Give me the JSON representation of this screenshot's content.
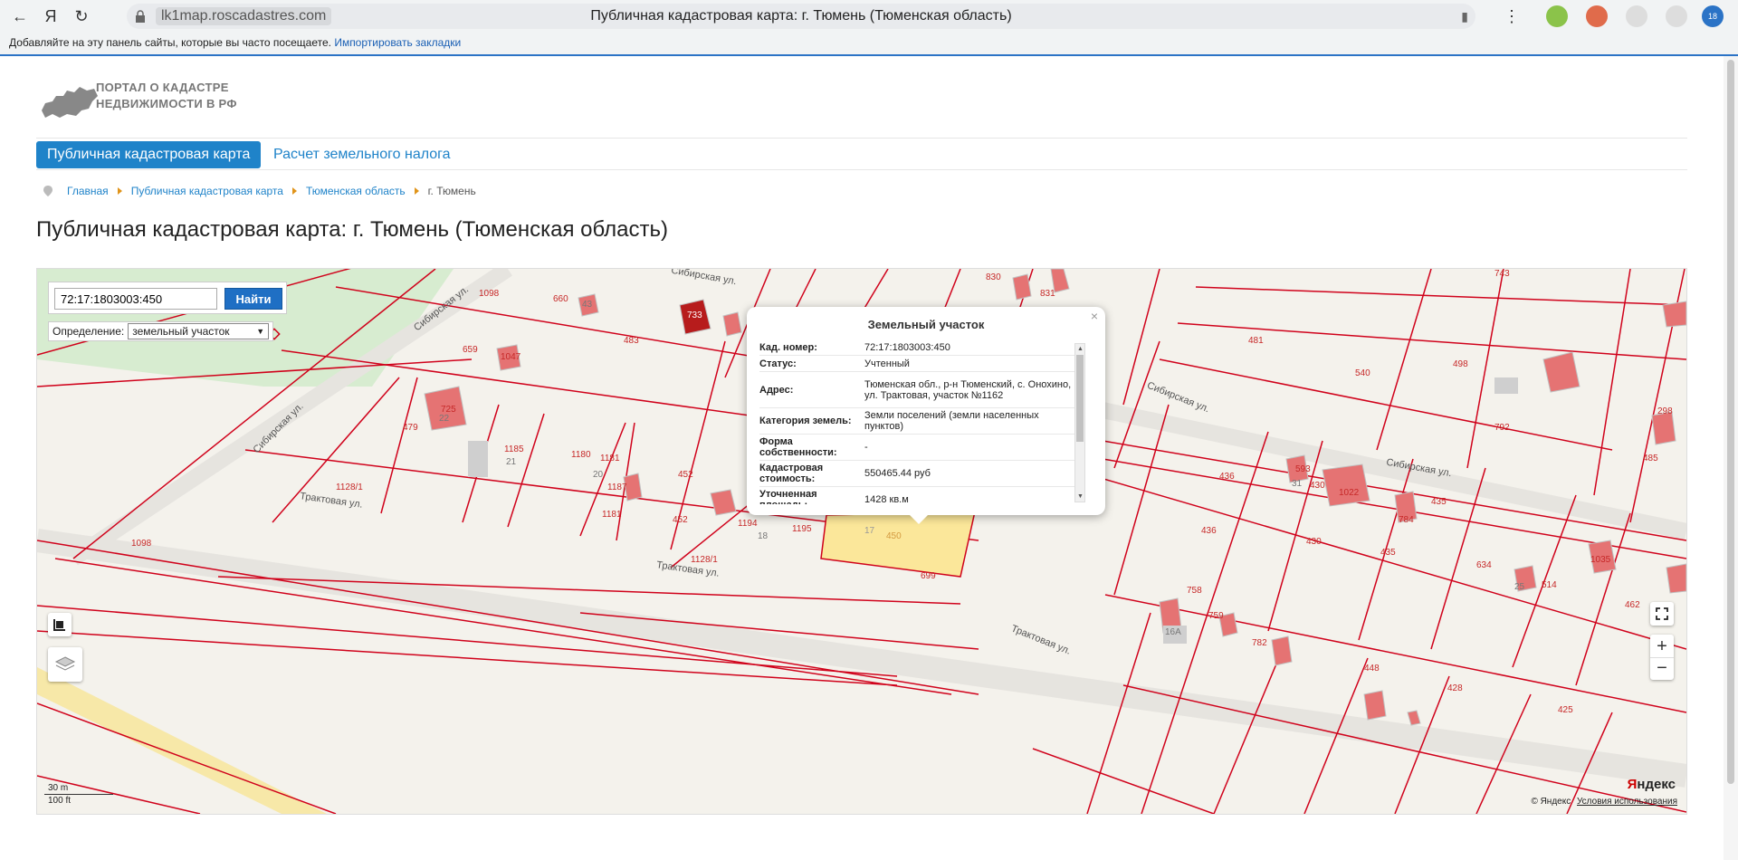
{
  "browser": {
    "host": "lk1map.roscadastres.com",
    "tab_title": "Публичная кадастровая карта: г. Тюмень (Тюменская область)",
    "bookmarks_hint": "Добавляйте на эту панель сайты, которые вы часто посещаете.",
    "import_bookmarks": "Импортировать закладки",
    "ext_badge": "18"
  },
  "site": {
    "logo_line1": "ПОРТАЛ О КАДАСТРЕ",
    "logo_line2": "НЕДВИЖИМОСТИ В РФ"
  },
  "tabs": {
    "active": "Публичная кадастровая карта",
    "link": "Расчет земельного налога"
  },
  "breadcrumb": [
    "Главная",
    "Публичная кадастровая карта",
    "Тюменская область",
    "г. Тюмень"
  ],
  "page_title": "Публичная кадастровая карта: г. Тюмень (Тюменская область)",
  "search": {
    "value": "72:17:1803003:450",
    "button": "Найти",
    "definition_label": "Определение:",
    "definition_value": "земельный участок"
  },
  "popup": {
    "title": "Земельный участок",
    "rows": [
      {
        "key": "Кад. номер:",
        "value": "72:17:1803003:450"
      },
      {
        "key": "Статус:",
        "value": "Учтенный"
      },
      {
        "key": "Адрес:",
        "value": "Тюменская обл., р-н Тюменский, с. Онохино, ул. Трактовая, участок №1162"
      },
      {
        "key": "Категория земель:",
        "value": "Земли поселений (земли населенных пунктов)"
      },
      {
        "key": "Форма собственности:",
        "value": "-"
      },
      {
        "key": "Кадастровая стоимость:",
        "value": "550465.44 руб"
      },
      {
        "key": "Уточненная площадь:",
        "value": "1428 кв.м"
      }
    ]
  },
  "map": {
    "scale_metric": "30 m",
    "scale_imperial": "100 ft",
    "attribution": "© Яндекс",
    "terms": "Условия использования",
    "yandex_logo_red": "Я",
    "yandex_logo_rest": "ндекс",
    "labels": [
      {
        "text": "1098"
      },
      {
        "text": "660"
      },
      {
        "text": "43"
      },
      {
        "text": "733"
      },
      {
        "text": "483"
      },
      {
        "text": "659"
      },
      {
        "text": "1047"
      },
      {
        "text": "479"
      },
      {
        "text": "22"
      },
      {
        "text": "725"
      },
      {
        "text": "1185"
      },
      {
        "text": "21"
      },
      {
        "text": "1180"
      },
      {
        "text": "1181"
      },
      {
        "text": "20"
      },
      {
        "text": "1187"
      },
      {
        "text": "452"
      },
      {
        "text": "1128/1"
      },
      {
        "text": "1098"
      },
      {
        "text": "1181"
      },
      {
        "text": "452"
      },
      {
        "text": "1194"
      },
      {
        "text": "1195"
      },
      {
        "text": "18"
      },
      {
        "text": "17"
      },
      {
        "text": "450"
      },
      {
        "text": "1128/1"
      },
      {
        "text": "699"
      },
      {
        "text": "830"
      },
      {
        "text": "831"
      },
      {
        "text": "481"
      },
      {
        "text": "540"
      },
      {
        "text": "498"
      },
      {
        "text": "792"
      },
      {
        "text": "743"
      },
      {
        "text": "298"
      },
      {
        "text": "485"
      },
      {
        "text": "436"
      },
      {
        "text": "430"
      },
      {
        "text": "1022"
      },
      {
        "text": "435"
      },
      {
        "text": "784"
      },
      {
        "text": "436"
      },
      {
        "text": "430"
      },
      {
        "text": "435"
      },
      {
        "text": "634"
      },
      {
        "text": "25"
      },
      {
        "text": "514"
      },
      {
        "text": "1035"
      },
      {
        "text": "462"
      },
      {
        "text": "758"
      },
      {
        "text": "759"
      },
      {
        "text": "782"
      },
      {
        "text": "448"
      },
      {
        "text": "428"
      },
      {
        "text": "425"
      },
      {
        "text": "16А"
      },
      {
        "text": "593"
      },
      {
        "text": "31"
      }
    ],
    "streets": [
      {
        "text": "Сибирская ул."
      },
      {
        "text": "Сибирская ул."
      },
      {
        "text": "Сибирская ул."
      },
      {
        "text": "Сибирская ул."
      },
      {
        "text": "Сибирская ул."
      },
      {
        "text": "Трактовая ул."
      },
      {
        "text": "Трактовая ул."
      },
      {
        "text": "Трактовая ул."
      }
    ]
  },
  "colors": {
    "accent": "#1f83c9",
    "parcel_line": "#d0021b",
    "selected_parcel": "#fbe79a",
    "building": "#e57373"
  }
}
